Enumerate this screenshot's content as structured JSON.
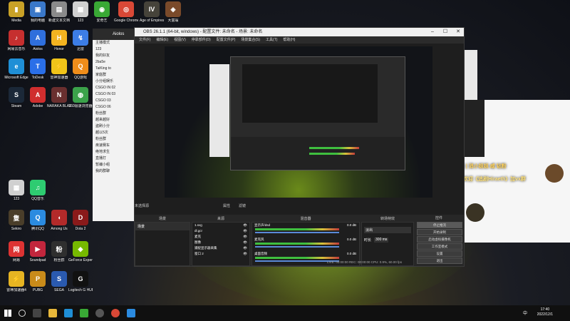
{
  "desktop": {
    "icons": [
      {
        "label": "Media",
        "color": "#c9a227",
        "glyph": "▮"
      },
      {
        "label": "我的电脑",
        "color": "#3a78c9",
        "glyph": "▣"
      },
      {
        "label": "新建文本文档",
        "color": "#8a8a8a",
        "glyph": "▤"
      },
      {
        "label": "123",
        "color": "#d0d0d0",
        "glyph": "▦"
      },
      {
        "label": "爱奇艺",
        "color": "#39a935",
        "glyph": "◉"
      },
      {
        "label": "Google Chrome",
        "color": "#d94836",
        "glyph": "◎"
      },
      {
        "label": "Age of Empires IV",
        "color": "#46433a",
        "glyph": "IV"
      },
      {
        "label": "大富翁",
        "color": "#7a4a2a",
        "glyph": "◈"
      },
      {
        "label": "网易云音乐",
        "color": "#c62f2f",
        "glyph": "♪"
      },
      {
        "label": "Aiolos",
        "color": "#2f6fdc",
        "glyph": "A"
      },
      {
        "label": "Honor",
        "color": "#f3b320",
        "glyph": "H"
      },
      {
        "label": "迅雷",
        "color": "#3c7de6",
        "glyph": "↯"
      },
      {
        "label": "Microsoft Edge",
        "color": "#1f8fd6",
        "glyph": "e"
      },
      {
        "label": "ToDesk",
        "color": "#2a6fe8",
        "glyph": "T"
      },
      {
        "label": "雷神加速器",
        "color": "#f0c419",
        "glyph": "⚡"
      },
      {
        "label": "QQ游戏",
        "color": "#f08d1a",
        "glyph": "Q"
      },
      {
        "label": "Steam",
        "color": "#1b2838",
        "glyph": "S"
      },
      {
        "label": "Adobe",
        "color": "#d02e2e",
        "glyph": "A"
      },
      {
        "label": "NARAKA BLADEPOINT",
        "color": "#6a2f2f",
        "glyph": "N"
      },
      {
        "label": "360极速浏览器",
        "color": "#3ba24a",
        "glyph": "◍"
      },
      {
        "label": "123",
        "color": "#d0d0d0",
        "glyph": "▦"
      },
      {
        "label": "QQ音乐",
        "color": "#2ecc71",
        "glyph": "♫"
      },
      {
        "label": "Sekiro",
        "color": "#4a3e2a",
        "glyph": "隻"
      },
      {
        "label": "腾讯QQ",
        "color": "#2b8be0",
        "glyph": "Q"
      },
      {
        "label": "Among Us",
        "color": "#b32a2a",
        "glyph": "◖"
      },
      {
        "label": "Dota 2",
        "color": "#8a1a1a",
        "glyph": "D"
      },
      {
        "label": "网易",
        "color": "#d33",
        "glyph": "网"
      },
      {
        "label": "Soundpad",
        "color": "#c2263d",
        "glyph": "▶"
      },
      {
        "label": "粉丝群",
        "color": "#2f2f2f",
        "glyph": "粉"
      },
      {
        "label": "GeForce Experience",
        "color": "#76b900",
        "glyph": "◆"
      },
      {
        "label": "雷神加速器4",
        "color": "#e6b422",
        "glyph": "⚡"
      },
      {
        "label": "PUBG",
        "color": "#c98b1a",
        "glyph": "P"
      },
      {
        "label": "SEGA",
        "color": "#2a5ab0",
        "glyph": "S"
      },
      {
        "label": "Logitech G HUB",
        "color": "#111",
        "glyph": "G"
      }
    ]
  },
  "chat_window": {
    "title": "Aiolos",
    "rows": [
      "主播模式",
      "123",
      "我的好友",
      "2ba5e",
      "TaiKing to",
      "家庭群",
      "小分组娱乐",
      "CSGO IN 02",
      "CSGO IN 03",
      "CSGO 03",
      "CSGO 06",
      "粉丝群",
      "越来越好",
      "盗刷小分",
      "越以5次",
      "粉丝群",
      "疾速赛车",
      "绝地求生",
      "直播打",
      "暂编小组",
      "我的群聊"
    ]
  },
  "obs": {
    "title": "OBS 26.1.1 (64-bit, windows) - 配置文件: 未命名 - 场景: 未命名",
    "menu": [
      "文件(F)",
      "编辑(E)",
      "视图(V)",
      "停靠部件(D)",
      "配置文件(P)",
      "场景集合(S)",
      "工具(T)",
      "帮助(H)"
    ],
    "transition_label": "未选择源",
    "props_label": "属性",
    "filters_label": "滤镜",
    "panels": {
      "scenes": {
        "header": "场景",
        "items": [
          "场景"
        ]
      },
      "sources": {
        "header": "来源",
        "items": [
          "1.svg",
          "dl.gcr",
          "麦克",
          "图像",
          "捕捉显示器采集",
          "窗口 2"
        ]
      },
      "mixer": {
        "header": "混音器",
        "channels": [
          {
            "name": "显示声/dsd",
            "db": "0.0 dB"
          },
          {
            "name": "麦克风",
            "db": "0.0 dB"
          },
          {
            "name": "桌面音频",
            "db": "0.0 dB"
          }
        ]
      },
      "transitions": {
        "header": "转场特效",
        "type": "淡出",
        "duration_label": "时长",
        "duration_value": "300 ms"
      },
      "controls": {
        "header": "控件",
        "buttons": [
          "停止推流",
          "开始录制",
          "启动虚拟摄像机",
          "工作室模式",
          "设置",
          "退出"
        ]
      }
    },
    "statusbar": "LIVE: 00:00:00   REC: 00:00:00   CPU: 0.9%, 60.00 fps"
  },
  "overlay_banner": {
    "line1": "| | 消小姐姐 咸 钻粉",
    "line2": "欢迎《追剧Hiraeth》加vx群"
  },
  "taskbar": {
    "clock_time": "17:40",
    "clock_date": "2022/12/1",
    "tray_text": "中"
  }
}
